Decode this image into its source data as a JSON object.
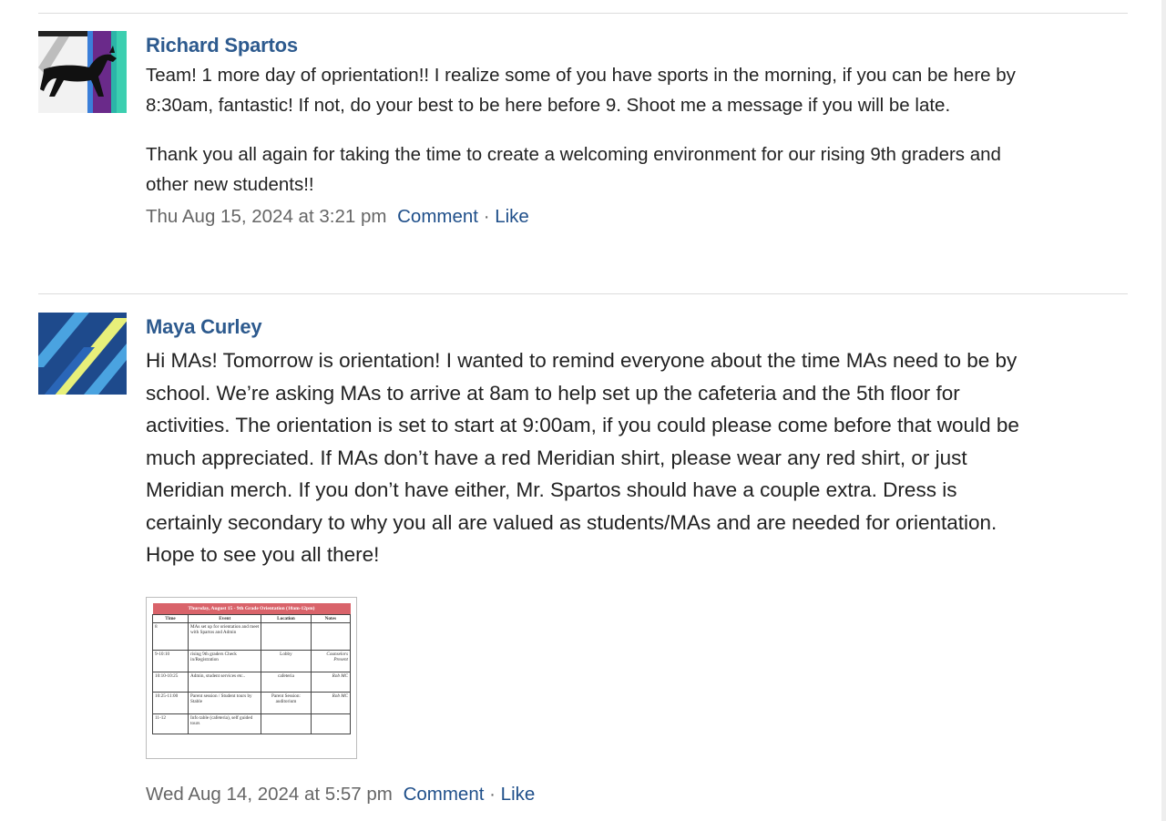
{
  "posts": [
    {
      "author": "Richard Spartos",
      "paragraphs": [
        "Team! 1 more day of oprientation!! I realize some of you have sports in the morning, if you can be here by 8:30am, fantastic! If not, do your best to be here before 9. Shoot me a message if you will be late.",
        "Thank you all again for taking the time to create a welcoming environment for our rising 9th graders and other new students!!"
      ],
      "timestamp": "Thu Aug 15, 2024 at 3:21 pm",
      "comment_label": "Comment",
      "separator": "·",
      "like_label": "Like"
    },
    {
      "author": "Maya Curley",
      "paragraphs": [
        "Hi MAs! Tomorrow is orientation! I wanted to remind everyone about the time MAs need to be by school. We’re asking MAs to arrive at 8am to help set up the cafeteria and the 5th floor for activities. The orientation is set to start at 9:00am, if you could please come before that would be much appreciated. If MAs don’t have a red Meridian shirt, please wear any red shirt, or just Meridian merch. If you don’t have either, Mr. Spartos should have a couple extra. Dress is certainly secondary to why you all are valued as students/MAs and are needed for orientation. Hope to see you all there!"
      ],
      "attachment": {
        "title": "Thursday, August 15 - 9th Grade Orientation (10am-12pm)",
        "headers": [
          "Time",
          "Event",
          "Location",
          "Notes"
        ],
        "rows": [
          [
            "8",
            "MAs set up for orientation and meet with Spartos and Admin",
            "",
            ""
          ],
          [
            "9-10:10",
            "rising 9th graders Check in/Registration",
            "Lobby",
            "Counselors Present"
          ],
          [
            "10:10-10:25",
            "Admin, student services etc..",
            "cafeteria",
            "Rob MC"
          ],
          [
            "10:25-11:00",
            "Parent session / Student tours by Stable",
            "Parent Session: auditorium",
            "Rob MC"
          ],
          [
            "11-12",
            "Info table (cafeteria), self guided tours",
            "",
            ""
          ]
        ]
      },
      "timestamp": "Wed Aug 14, 2024 at 5:57 pm",
      "comment_label": "Comment",
      "separator": "·",
      "like_label": "Like"
    }
  ]
}
